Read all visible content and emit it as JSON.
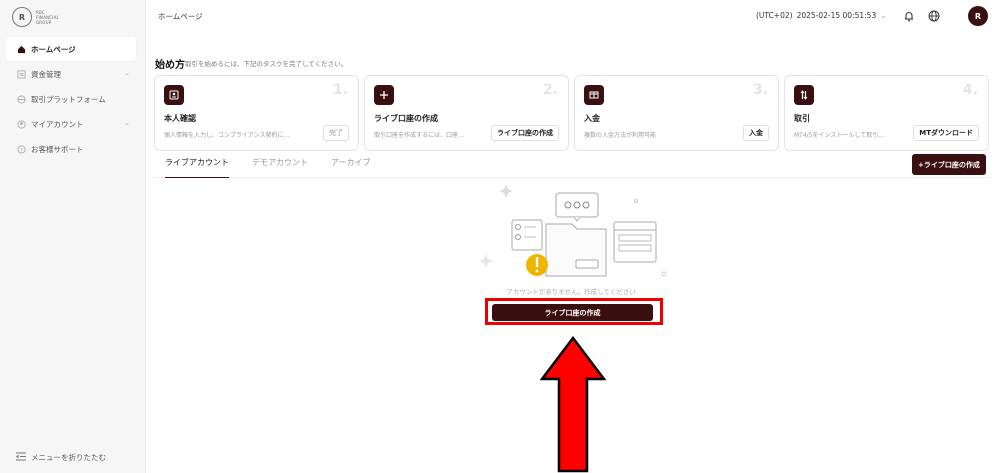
{
  "brand": {
    "logo_text": [
      "RBC",
      "FINANCIAL",
      "GROUP"
    ]
  },
  "sidebar": {
    "items": [
      {
        "label": "ホームページ",
        "icon": "home-icon",
        "active": true
      },
      {
        "label": "資金管理",
        "icon": "wallet-icon",
        "chevron": true
      },
      {
        "label": "取引プラットフォーム",
        "icon": "platform-icon"
      },
      {
        "label": "マイアカウント",
        "icon": "user-icon",
        "chevron": true
      },
      {
        "label": "お客様サポート",
        "icon": "support-icon"
      }
    ],
    "collapse_label": "メニューを折りたたむ"
  },
  "header": {
    "breadcrumb": "ホームページ",
    "timezone": "(UTC+02)",
    "datetime": "2025-02-15 00:51:53",
    "avatar_initial": "R"
  },
  "getting_started": {
    "title": "始め方",
    "subtitle": "取引を始めるには、下記のタスクを完了してください。",
    "cards": [
      {
        "num": "1.",
        "title": "本人確認",
        "desc": "個人情報を入力し、コンプライアンス契約に…",
        "button": "完了",
        "disabled": true,
        "icon": "id-card-icon"
      },
      {
        "num": "2.",
        "title": "ライブ口座の作成",
        "desc": "取引口座を作成するには、口座…",
        "button": "ライブ口座の作成",
        "disabled": false,
        "icon": "plus-icon"
      },
      {
        "num": "3.",
        "title": "入金",
        "desc": "複数の入金方法が利用可能",
        "button": "入金",
        "disabled": false,
        "icon": "deposit-icon"
      },
      {
        "num": "4.",
        "title": "取引",
        "desc": "MT4/5をインストールして取引…",
        "button": "MTダウンロード",
        "disabled": false,
        "icon": "trade-icon"
      }
    ]
  },
  "tabs": [
    {
      "label": "ライブアカウント",
      "active": true
    },
    {
      "label": "デモアカウント",
      "active": false
    },
    {
      "label": "アーカイブ",
      "active": false
    }
  ],
  "create_live_top": "+ライブ口座の作成",
  "empty_state": {
    "message": "アカウントがありません。作成してください",
    "button": "ライブ口座の作成"
  },
  "colors": {
    "brand": "#3a0f10",
    "highlight": "#e00000"
  }
}
